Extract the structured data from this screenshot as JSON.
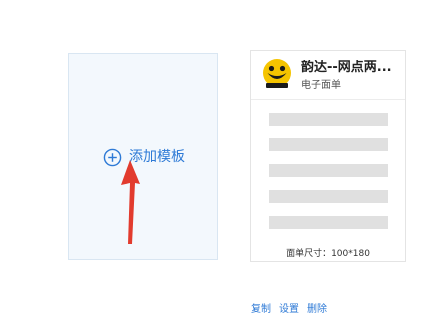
{
  "add_template": {
    "label": "添加模板"
  },
  "template_card": {
    "title": "韵达--网点两...",
    "subtitle": "电子面单",
    "size_text": "面单尺寸：100*180"
  },
  "actions": {
    "copy": "复制",
    "settings": "设置",
    "delete": "删除"
  },
  "icons": {
    "add": "plus-circle-icon",
    "pointer": "red-arrow-icon",
    "logo": "yunda-express-logo-icon"
  },
  "colors": {
    "link_blue": "#2e7ad6",
    "arrow_red": "#e23b2e",
    "logo_yellow": "#f5c400",
    "card_bg": "#f3f8fd",
    "placeholder_gray": "#e0e0e0"
  }
}
